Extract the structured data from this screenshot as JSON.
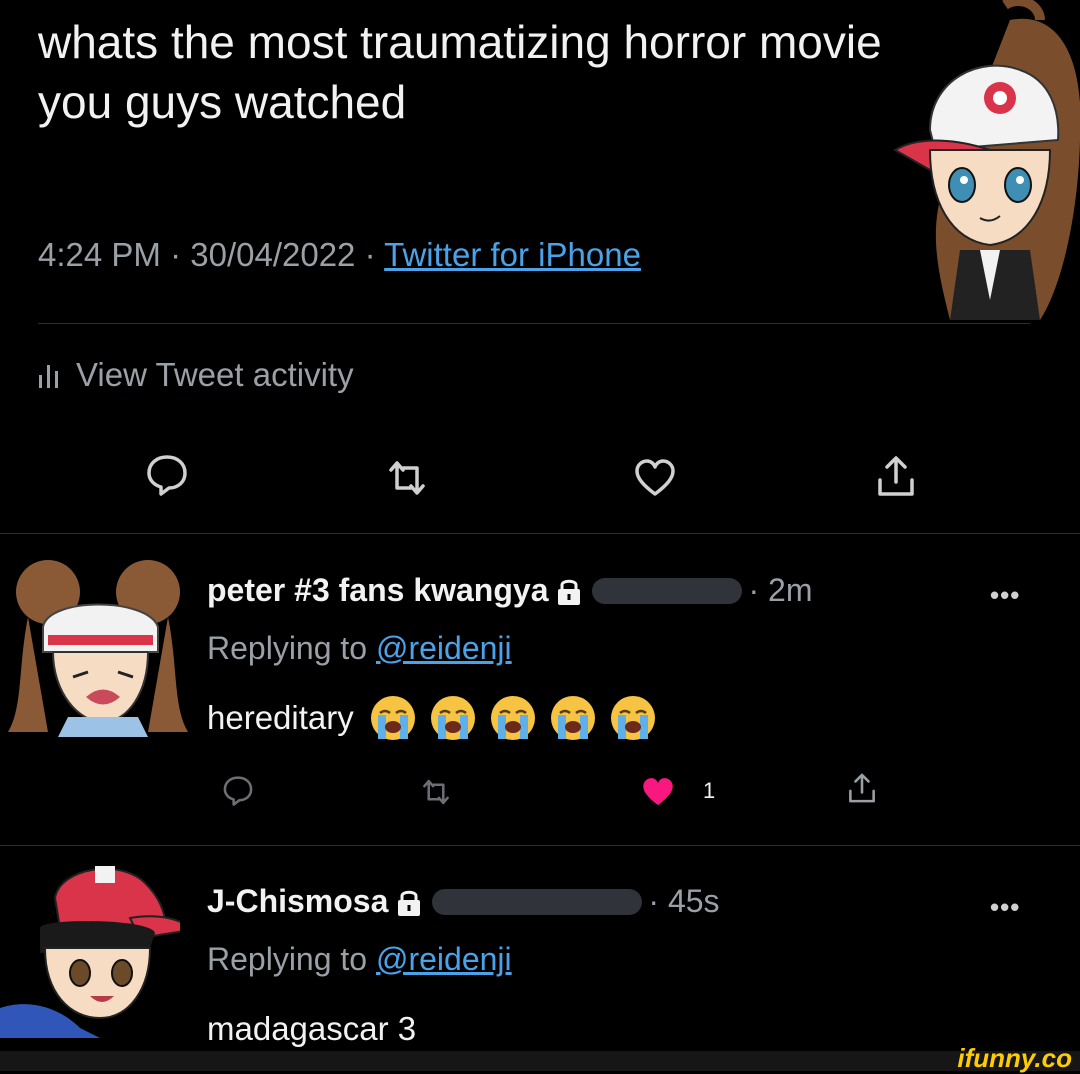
{
  "tweet": {
    "text": "whats the most traumatizing horror movie you guys watched",
    "time": "4:24 PM",
    "sep1": " · ",
    "date": "30/04/2022",
    "sep2": " · ",
    "source": "Twitter for iPhone",
    "activity_label": "View Tweet activity"
  },
  "replies": [
    {
      "name": "peter #3 fans kwangya",
      "time": "· 2m",
      "more": "•••",
      "replying_prefix": "Replying to ",
      "handle": "@reidenji",
      "text": "hereditary",
      "emoji_count": 5,
      "like_count": "1"
    },
    {
      "name": "J-Chismosa",
      "time": "· 45s",
      "more": "•••",
      "replying_prefix": "Replying to ",
      "handle": "@reidenji",
      "text": "madagascar 3"
    }
  ],
  "watermark": "ifunny.co",
  "colors": {
    "background": "#000000",
    "link": "#4aa3e8",
    "muted": "#9aa0a6",
    "like": "#f91880"
  },
  "icons": [
    "reply-icon",
    "retweet-icon",
    "like-icon",
    "share-icon",
    "lock-icon",
    "stats-icon",
    "crying-emoji-icon"
  ]
}
